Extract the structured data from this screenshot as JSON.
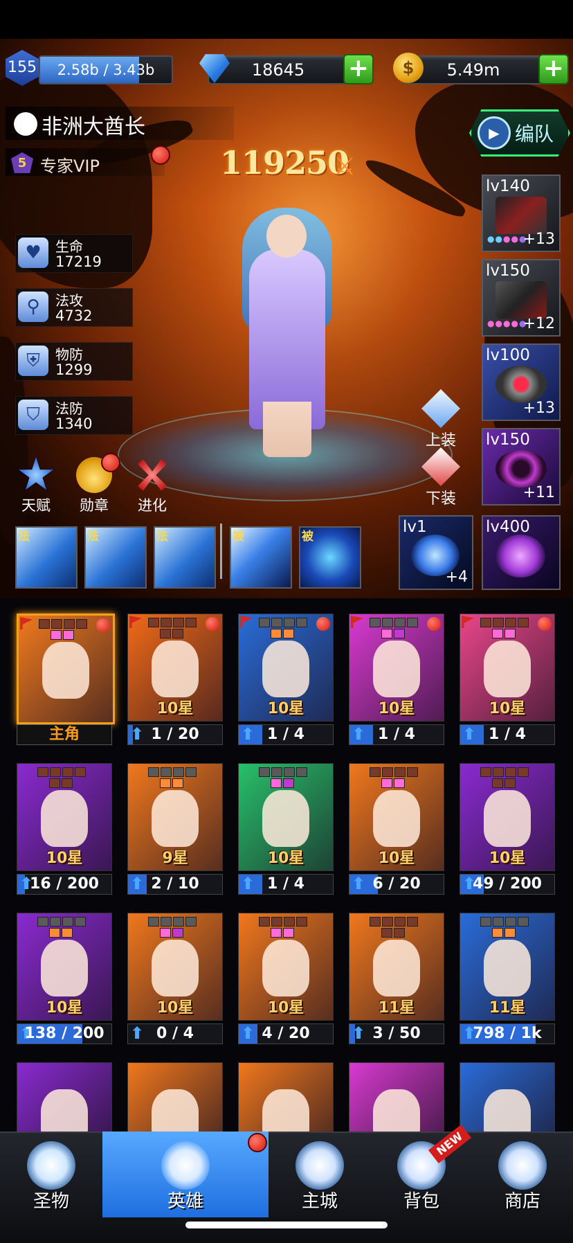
{
  "player": {
    "level": "155",
    "xp_text": "2.58b / 3.43b",
    "xp_fraction": 0.75,
    "gems": "18645",
    "coins": "5.49m",
    "coin_symbol": "$",
    "name": "非洲大酋长",
    "vip_level": "5",
    "vip_label": "专家VIP",
    "power": "119250"
  },
  "team_button": {
    "label": "编队"
  },
  "stats": [
    {
      "label": "生命",
      "value": "17219",
      "icon": "heart-icon"
    },
    {
      "label": "法攻",
      "value": "4732",
      "icon": "magic-staff-icon"
    },
    {
      "label": "物防",
      "value": "1299",
      "icon": "shield-sword-icon"
    },
    {
      "label": "法防",
      "value": "1340",
      "icon": "shield-magic-icon"
    }
  ],
  "char_buttons": [
    {
      "label": "天赋",
      "icon": "star-talent-icon"
    },
    {
      "label": "勋章",
      "icon": "medal-icon"
    },
    {
      "label": "进化",
      "icon": "evolve-icon"
    }
  ],
  "gear_buttons": {
    "equip": "上装",
    "unequip": "下装"
  },
  "skills": [
    {
      "tag": "法",
      "icon": "ice-crystal-skill-icon"
    },
    {
      "tag": "法",
      "icon": "snowflake-skill-icon"
    },
    {
      "tag": "法",
      "icon": "blizzard-skill-icon"
    },
    {
      "tag": "被",
      "icon": "blade-passive-icon"
    },
    {
      "tag": "被",
      "icon": "shield-passive-icon"
    }
  ],
  "equipment": [
    {
      "lv": "lv140",
      "plus": "+13",
      "icon": "staff-weapon-icon"
    },
    {
      "lv": "lv150",
      "plus": "+12",
      "icon": "armor-icon"
    },
    {
      "lv": "lv100",
      "plus": "+13",
      "icon": "ring-icon"
    },
    {
      "lv": "lv150",
      "plus": "+11",
      "icon": "amulet-icon"
    }
  ],
  "relics": [
    {
      "lv": "lv1",
      "plus": "+4",
      "icon": "relic-crystal-icon"
    },
    {
      "lv": "lv400",
      "plus": "",
      "icon": "relic-spirit-icon"
    }
  ],
  "heroes": [
    {
      "stars": "",
      "progress": "主角",
      "fill": 0,
      "is_main": true,
      "color": "#f07a1e"
    },
    {
      "stars": "10星",
      "progress": "1 / 20",
      "fill": 0.05,
      "color": "#f26a18"
    },
    {
      "stars": "10星",
      "progress": "1 / 4",
      "fill": 0.25,
      "color": "#2a6cd8"
    },
    {
      "stars": "10星",
      "progress": "1 / 4",
      "fill": 0.25,
      "color": "#d83ad0"
    },
    {
      "stars": "10星",
      "progress": "1 / 4",
      "fill": 0.25,
      "color": "#e9468a"
    },
    {
      "stars": "10星",
      "progress": "16 / 200",
      "fill": 0.08,
      "color": "#8a2ad0"
    },
    {
      "stars": "9星",
      "progress": "2 / 10",
      "fill": 0.2,
      "color": "#f0781e"
    },
    {
      "stars": "10星",
      "progress": "1 / 4",
      "fill": 0.25,
      "color": "#28c06a"
    },
    {
      "stars": "10星",
      "progress": "6 / 20",
      "fill": 0.3,
      "color": "#f0781e"
    },
    {
      "stars": "10星",
      "progress": "49 / 200",
      "fill": 0.25,
      "color": "#8a2ad0"
    },
    {
      "stars": "10星",
      "progress": "138 / 200",
      "fill": 0.69,
      "color": "#8a2ad0"
    },
    {
      "stars": "10星",
      "progress": "0 / 4",
      "fill": 0,
      "color": "#f0781e"
    },
    {
      "stars": "10星",
      "progress": "4 / 20",
      "fill": 0.2,
      "color": "#f0781e"
    },
    {
      "stars": "11星",
      "progress": "3 / 50",
      "fill": 0.06,
      "color": "#f0781e"
    },
    {
      "stars": "11星",
      "progress": "798 / 1k",
      "fill": 0.8,
      "color": "#2a6cd8"
    },
    {
      "stars": "",
      "progress": "",
      "fill": 0,
      "color": "#8a2ad0"
    },
    {
      "stars": "",
      "progress": "",
      "fill": 0,
      "color": "#f0781e"
    },
    {
      "stars": "",
      "progress": "",
      "fill": 0,
      "color": "#f0781e"
    },
    {
      "stars": "",
      "progress": "",
      "fill": 0,
      "color": "#d83ad0"
    },
    {
      "stars": "",
      "progress": "",
      "fill": 0,
      "color": "#2a6cd8"
    }
  ],
  "nav": [
    {
      "label": "圣物",
      "icon": "clover-icon",
      "active": false
    },
    {
      "label": "英雄",
      "icon": "hero-helmet-icon",
      "active": true
    },
    {
      "label": "主城",
      "icon": "castle-icon",
      "active": false
    },
    {
      "label": "背包",
      "icon": "backpack-icon",
      "active": false,
      "badge": "NEW"
    },
    {
      "label": "商店",
      "icon": "shop-basket-icon",
      "active": false
    }
  ],
  "colors": {
    "accent_green": "#35ff7a",
    "selected_orange": "#f2a11e",
    "active_nav_blue": "#3b8cf0",
    "red_dot": "#d41a0c"
  }
}
